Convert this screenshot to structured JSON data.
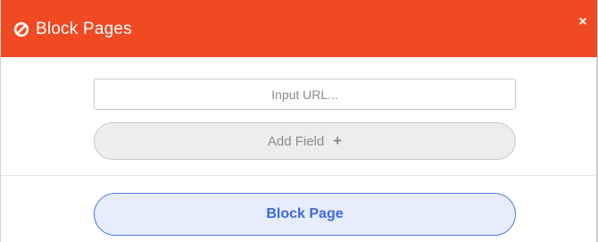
{
  "header": {
    "title": "Block Pages",
    "title_icon": "block-icon",
    "close_label": "×",
    "background_color": "#f04a23"
  },
  "form": {
    "url_placeholder": "Input URL...",
    "url_value": "",
    "add_field_label": "Add Field",
    "add_field_icon": "plus-icon",
    "add_field_icon_glyph": "+"
  },
  "footer": {
    "block_page_label": "Block Page",
    "accent_color": "#3e69de"
  }
}
